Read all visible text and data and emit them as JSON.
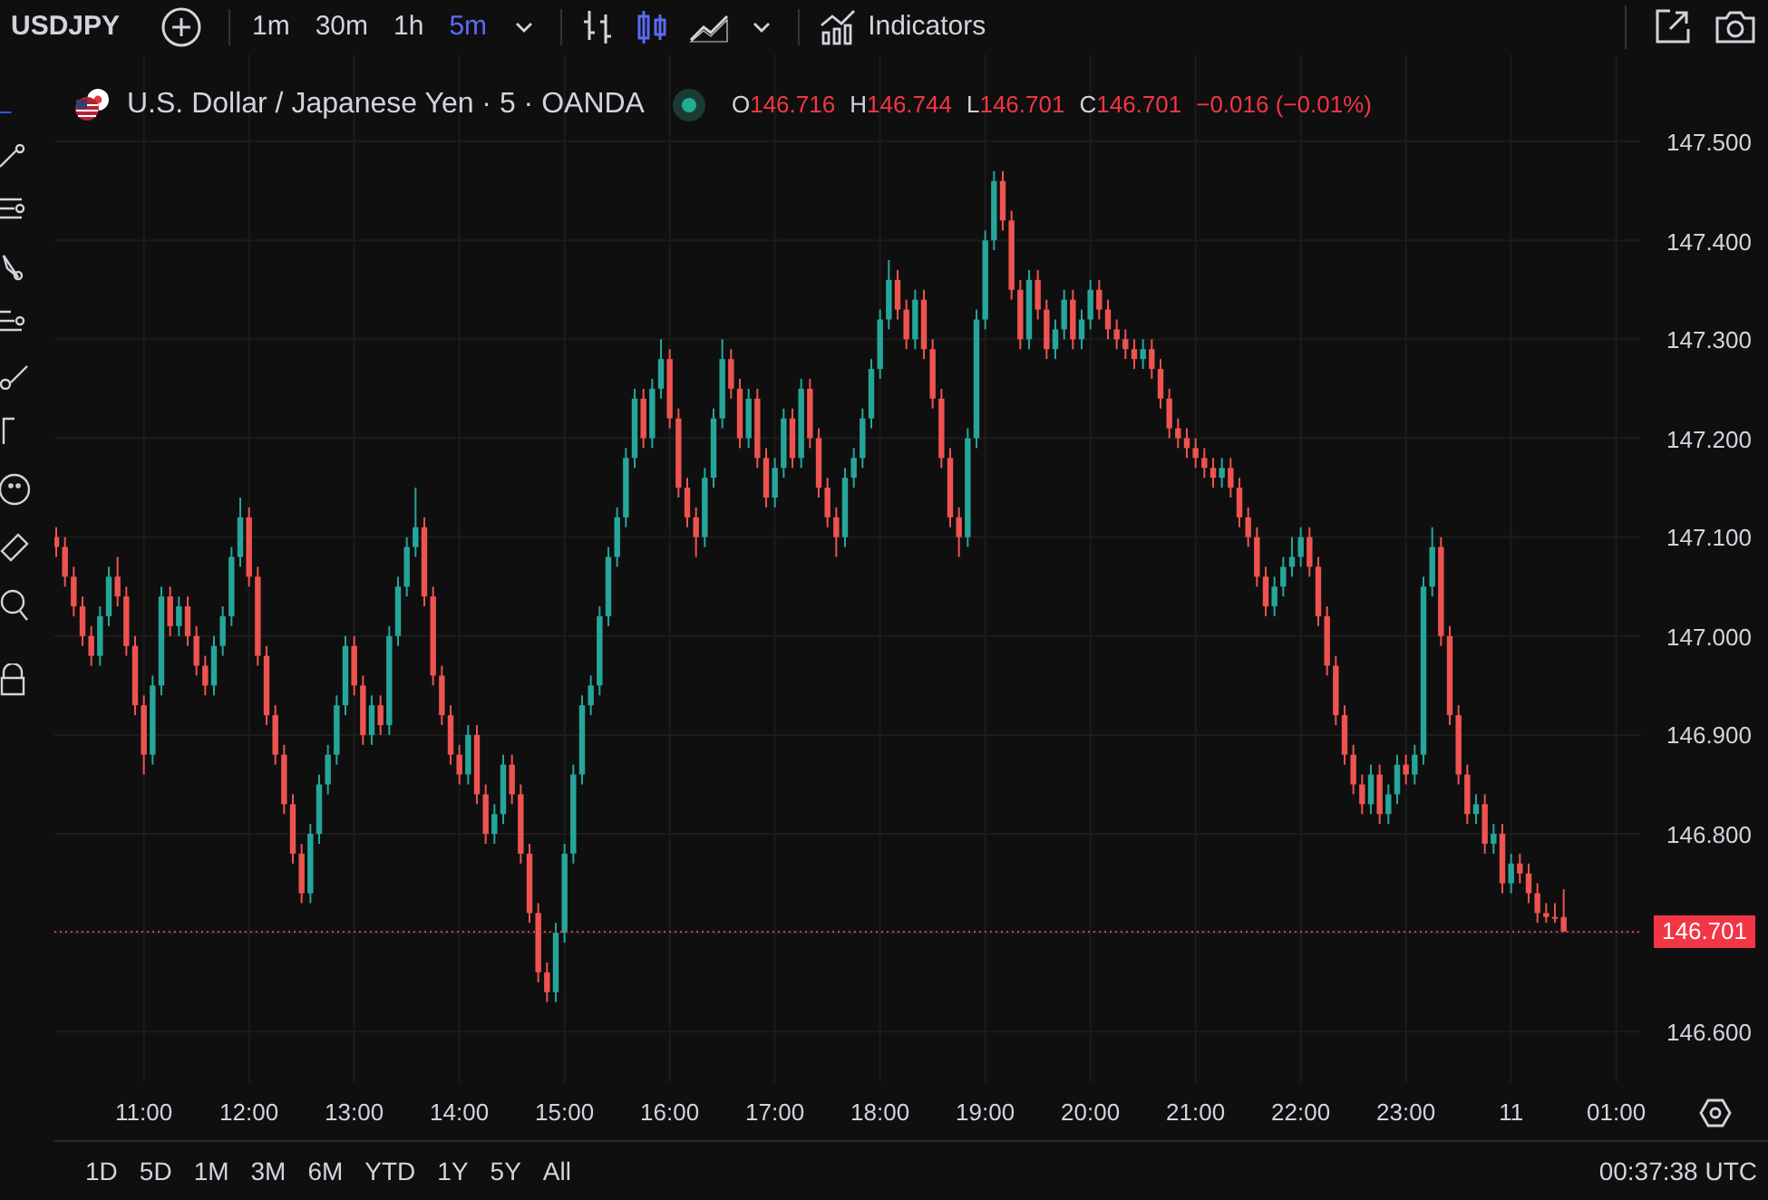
{
  "toolbar": {
    "symbol": "USDJPY",
    "intervals": [
      {
        "label": "1m",
        "selected": false
      },
      {
        "label": "30m",
        "selected": false
      },
      {
        "label": "1h",
        "selected": false
      },
      {
        "label": "5m",
        "selected": true
      }
    ],
    "chart_types": [
      {
        "kind": "bars",
        "selected": false
      },
      {
        "kind": "candles",
        "selected": true
      },
      {
        "kind": "area",
        "selected": false
      }
    ],
    "indicators": "Indicators"
  },
  "legend": {
    "title": "U.S. Dollar / Japanese Yen · 5 · OANDA",
    "values": [
      {
        "label": "O",
        "value": "146.716"
      },
      {
        "label": "H",
        "value": "146.744"
      },
      {
        "label": "L",
        "value": "146.701"
      },
      {
        "label": "C",
        "value": "146.701"
      }
    ],
    "change": "−0.016 (−0.01%)"
  },
  "chart_data": {
    "type": "candlestick",
    "ylim": [
      146.549,
      147.588
    ],
    "grid": true,
    "xlim": [
      10.1494,
      25.2356
    ],
    "x": [
      10.1667,
      10.25,
      10.3333,
      10.4167,
      10.5,
      10.5833,
      10.6667,
      10.75,
      10.8333,
      10.9167,
      11,
      11.0833,
      11.1667,
      11.25,
      11.3333,
      11.4167,
      11.5,
      11.5833,
      11.6667,
      11.75,
      11.8333,
      11.9167,
      12,
      12.0833,
      12.1667,
      12.25,
      12.3333,
      12.4167,
      12.5,
      12.5833,
      12.6667,
      12.75,
      12.8333,
      12.9167,
      13,
      13.0833,
      13.1667,
      13.25,
      13.3333,
      13.4167,
      13.5,
      13.5833,
      13.6667,
      13.75,
      13.8333,
      13.9167,
      14,
      14.0833,
      14.1667,
      14.25,
      14.3333,
      14.4167,
      14.5,
      14.5833,
      14.6667,
      14.75,
      14.8333,
      14.9167,
      15,
      15.0833,
      15.1667,
      15.25,
      15.3333,
      15.4167,
      15.5,
      15.5833,
      15.6667,
      15.75,
      15.8333,
      15.9167,
      16,
      16.0833,
      16.1667,
      16.25,
      16.3333,
      16.4167,
      16.5,
      16.5833,
      16.6667,
      16.75,
      16.8333,
      16.9167,
      17,
      17.0833,
      17.1667,
      17.25,
      17.3333,
      17.4167,
      17.5,
      17.5833,
      17.6667,
      17.75,
      17.8333,
      17.9167,
      18,
      18.0833,
      18.1667,
      18.25,
      18.3333,
      18.4167,
      18.5,
      18.5833,
      18.6667,
      18.75,
      18.8333,
      18.9167,
      19,
      19.0833,
      19.1667,
      19.25,
      19.3333,
      19.4167,
      19.5,
      19.5833,
      19.6667,
      19.75,
      19.8333,
      19.9167,
      20,
      20.0833,
      20.1667,
      20.25,
      20.3333,
      20.4167,
      20.5,
      20.5833,
      20.6667,
      20.75,
      20.8333,
      20.9167,
      21,
      21.0833,
      21.1667,
      21.25,
      21.3333,
      21.4167,
      21.5,
      21.5833,
      21.6667,
      21.75,
      21.8333,
      21.9167,
      22,
      22.0833,
      22.1667,
      22.25,
      22.3333,
      22.4167,
      22.5,
      22.5833,
      22.6667,
      22.75,
      22.8333,
      22.9167,
      23,
      23.0833,
      23.1667,
      23.25,
      23.3333,
      23.4167,
      23.5,
      23.5833,
      23.6667,
      23.75,
      23.8333,
      23.9167,
      24,
      24.0833,
      24.1667,
      24.25,
      24.3333,
      24.4167,
      24.5
    ],
    "ohlc": [
      [
        147.1,
        147.11,
        147.08,
        147.09
      ],
      [
        147.09,
        147.1,
        147.05,
        147.06
      ],
      [
        147.06,
        147.07,
        147.02,
        147.03
      ],
      [
        147.03,
        147.04,
        146.99,
        147.0
      ],
      [
        147.0,
        147.01,
        146.97,
        146.98
      ],
      [
        146.98,
        147.03,
        146.97,
        147.02
      ],
      [
        147.02,
        147.07,
        147.01,
        147.06
      ],
      [
        147.06,
        147.08,
        147.03,
        147.04
      ],
      [
        147.04,
        147.05,
        146.98,
        146.99
      ],
      [
        146.99,
        147.0,
        146.92,
        146.93
      ],
      [
        146.93,
        146.94,
        146.86,
        146.88
      ],
      [
        146.88,
        146.96,
        146.87,
        146.95
      ],
      [
        146.95,
        147.05,
        146.94,
        147.04
      ],
      [
        147.04,
        147.05,
        147.0,
        147.01
      ],
      [
        147.01,
        147.04,
        147.0,
        147.03
      ],
      [
        147.03,
        147.04,
        146.99,
        147.0
      ],
      [
        147.0,
        147.01,
        146.96,
        146.97
      ],
      [
        146.97,
        146.98,
        146.94,
        146.95
      ],
      [
        146.95,
        147.0,
        146.94,
        146.99
      ],
      [
        146.99,
        147.03,
        146.98,
        147.02
      ],
      [
        147.02,
        147.09,
        147.01,
        147.08
      ],
      [
        147.08,
        147.14,
        147.07,
        147.12
      ],
      [
        147.12,
        147.13,
        147.05,
        147.06
      ],
      [
        147.06,
        147.07,
        146.97,
        146.98
      ],
      [
        146.98,
        146.99,
        146.91,
        146.92
      ],
      [
        146.92,
        146.93,
        146.87,
        146.88
      ],
      [
        146.88,
        146.89,
        146.82,
        146.83
      ],
      [
        146.83,
        146.84,
        146.77,
        146.78
      ],
      [
        146.78,
        146.79,
        146.73,
        146.74
      ],
      [
        146.74,
        146.81,
        146.73,
        146.8
      ],
      [
        146.8,
        146.86,
        146.79,
        146.85
      ],
      [
        146.85,
        146.89,
        146.84,
        146.88
      ],
      [
        146.88,
        146.94,
        146.87,
        146.93
      ],
      [
        146.93,
        147.0,
        146.92,
        146.99
      ],
      [
        146.99,
        147.0,
        146.94,
        146.95
      ],
      [
        146.95,
        146.96,
        146.89,
        146.9
      ],
      [
        146.9,
        146.94,
        146.89,
        146.93
      ],
      [
        146.93,
        146.94,
        146.9,
        146.91
      ],
      [
        146.91,
        147.01,
        146.9,
        147.0
      ],
      [
        147.0,
        147.06,
        146.99,
        147.05
      ],
      [
        147.05,
        147.1,
        147.04,
        147.09
      ],
      [
        147.09,
        147.15,
        147.08,
        147.11
      ],
      [
        147.11,
        147.12,
        147.03,
        147.04
      ],
      [
        147.04,
        147.05,
        146.95,
        146.96
      ],
      [
        146.96,
        146.97,
        146.91,
        146.92
      ],
      [
        146.92,
        146.93,
        146.87,
        146.88
      ],
      [
        146.88,
        146.89,
        146.85,
        146.86
      ],
      [
        146.86,
        146.91,
        146.85,
        146.9
      ],
      [
        146.9,
        146.91,
        146.83,
        146.84
      ],
      [
        146.84,
        146.85,
        146.79,
        146.8
      ],
      [
        146.8,
        146.83,
        146.79,
        146.82
      ],
      [
        146.82,
        146.88,
        146.81,
        146.87
      ],
      [
        146.87,
        146.88,
        146.83,
        146.84
      ],
      [
        146.84,
        146.85,
        146.77,
        146.78
      ],
      [
        146.78,
        146.79,
        146.71,
        146.72
      ],
      [
        146.72,
        146.73,
        146.65,
        146.66
      ],
      [
        146.66,
        146.67,
        146.63,
        146.64
      ],
      [
        146.64,
        146.71,
        146.63,
        146.7
      ],
      [
        146.7,
        146.79,
        146.69,
        146.78
      ],
      [
        146.78,
        146.87,
        146.77,
        146.86
      ],
      [
        146.86,
        146.94,
        146.85,
        146.93
      ],
      [
        146.93,
        146.96,
        146.92,
        146.95
      ],
      [
        146.95,
        147.03,
        146.94,
        147.02
      ],
      [
        147.02,
        147.09,
        147.01,
        147.08
      ],
      [
        147.08,
        147.13,
        147.07,
        147.12
      ],
      [
        147.12,
        147.19,
        147.11,
        147.18
      ],
      [
        147.18,
        147.25,
        147.17,
        147.24
      ],
      [
        147.24,
        147.25,
        147.19,
        147.2
      ],
      [
        147.2,
        147.26,
        147.19,
        147.25
      ],
      [
        147.25,
        147.3,
        147.24,
        147.28
      ],
      [
        147.28,
        147.29,
        147.21,
        147.22
      ],
      [
        147.22,
        147.23,
        147.14,
        147.15
      ],
      [
        147.15,
        147.16,
        147.11,
        147.12
      ],
      [
        147.12,
        147.13,
        147.08,
        147.1
      ],
      [
        147.1,
        147.17,
        147.09,
        147.16
      ],
      [
        147.16,
        147.23,
        147.15,
        147.22
      ],
      [
        147.22,
        147.3,
        147.21,
        147.28
      ],
      [
        147.28,
        147.29,
        147.24,
        147.25
      ],
      [
        147.25,
        147.26,
        147.19,
        147.2
      ],
      [
        147.2,
        147.25,
        147.19,
        147.24
      ],
      [
        147.24,
        147.25,
        147.17,
        147.18
      ],
      [
        147.18,
        147.19,
        147.13,
        147.14
      ],
      [
        147.14,
        147.18,
        147.13,
        147.17
      ],
      [
        147.17,
        147.23,
        147.16,
        147.22
      ],
      [
        147.22,
        147.23,
        147.17,
        147.18
      ],
      [
        147.18,
        147.26,
        147.17,
        147.25
      ],
      [
        147.25,
        147.26,
        147.19,
        147.2
      ],
      [
        147.2,
        147.21,
        147.14,
        147.15
      ],
      [
        147.15,
        147.16,
        147.11,
        147.12
      ],
      [
        147.12,
        147.13,
        147.08,
        147.1
      ],
      [
        147.1,
        147.17,
        147.09,
        147.16
      ],
      [
        147.16,
        147.19,
        147.15,
        147.18
      ],
      [
        147.18,
        147.23,
        147.17,
        147.22
      ],
      [
        147.22,
        147.28,
        147.21,
        147.27
      ],
      [
        147.27,
        147.33,
        147.26,
        147.32
      ],
      [
        147.32,
        147.38,
        147.31,
        147.36
      ],
      [
        147.36,
        147.37,
        147.32,
        147.33
      ],
      [
        147.33,
        147.34,
        147.29,
        147.3
      ],
      [
        147.3,
        147.35,
        147.29,
        147.34
      ],
      [
        147.34,
        147.35,
        147.28,
        147.29
      ],
      [
        147.29,
        147.3,
        147.23,
        147.24
      ],
      [
        147.24,
        147.25,
        147.17,
        147.18
      ],
      [
        147.18,
        147.19,
        147.11,
        147.12
      ],
      [
        147.12,
        147.13,
        147.08,
        147.1
      ],
      [
        147.1,
        147.21,
        147.09,
        147.2
      ],
      [
        147.2,
        147.33,
        147.19,
        147.32
      ],
      [
        147.32,
        147.41,
        147.31,
        147.4
      ],
      [
        147.4,
        147.47,
        147.39,
        147.46
      ],
      [
        147.46,
        147.47,
        147.41,
        147.42
      ],
      [
        147.42,
        147.43,
        147.34,
        147.35
      ],
      [
        147.35,
        147.36,
        147.29,
        147.3
      ],
      [
        147.3,
        147.37,
        147.29,
        147.36
      ],
      [
        147.36,
        147.37,
        147.32,
        147.33
      ],
      [
        147.33,
        147.34,
        147.28,
        147.29
      ],
      [
        147.29,
        147.32,
        147.28,
        147.31
      ],
      [
        147.31,
        147.35,
        147.3,
        147.34
      ],
      [
        147.34,
        147.35,
        147.29,
        147.3
      ],
      [
        147.3,
        147.33,
        147.29,
        147.32
      ],
      [
        147.32,
        147.36,
        147.31,
        147.35
      ],
      [
        147.35,
        147.36,
        147.32,
        147.33
      ],
      [
        147.33,
        147.34,
        147.3,
        147.31
      ],
      [
        147.31,
        147.32,
        147.29,
        147.3
      ],
      [
        147.3,
        147.31,
        147.28,
        147.29
      ],
      [
        147.29,
        147.3,
        147.27,
        147.28
      ],
      [
        147.28,
        147.3,
        147.27,
        147.29
      ],
      [
        147.29,
        147.3,
        147.26,
        147.27
      ],
      [
        147.27,
        147.28,
        147.23,
        147.24
      ],
      [
        147.24,
        147.25,
        147.2,
        147.21
      ],
      [
        147.21,
        147.22,
        147.19,
        147.2
      ],
      [
        147.2,
        147.21,
        147.18,
        147.19
      ],
      [
        147.19,
        147.2,
        147.17,
        147.18
      ],
      [
        147.18,
        147.19,
        147.16,
        147.17
      ],
      [
        147.17,
        147.18,
        147.15,
        147.16
      ],
      [
        147.16,
        147.18,
        147.15,
        147.17
      ],
      [
        147.17,
        147.18,
        147.14,
        147.15
      ],
      [
        147.15,
        147.16,
        147.11,
        147.12
      ],
      [
        147.12,
        147.13,
        147.09,
        147.1
      ],
      [
        147.1,
        147.11,
        147.05,
        147.06
      ],
      [
        147.06,
        147.07,
        147.02,
        147.03
      ],
      [
        147.03,
        147.06,
        147.02,
        147.05
      ],
      [
        147.05,
        147.08,
        147.04,
        147.07
      ],
      [
        147.07,
        147.1,
        147.06,
        147.08
      ],
      [
        147.08,
        147.11,
        147.07,
        147.1
      ],
      [
        147.1,
        147.11,
        147.06,
        147.07
      ],
      [
        147.07,
        147.08,
        147.01,
        147.02
      ],
      [
        147.02,
        147.03,
        146.96,
        146.97
      ],
      [
        146.97,
        146.98,
        146.91,
        146.92
      ],
      [
        146.92,
        146.93,
        146.87,
        146.88
      ],
      [
        146.88,
        146.89,
        146.84,
        146.85
      ],
      [
        146.85,
        146.86,
        146.82,
        146.83
      ],
      [
        146.83,
        146.87,
        146.82,
        146.86
      ],
      [
        146.86,
        146.87,
        146.81,
        146.82
      ],
      [
        146.82,
        146.85,
        146.81,
        146.84
      ],
      [
        146.84,
        146.88,
        146.83,
        146.87
      ],
      [
        146.87,
        146.88,
        146.85,
        146.86
      ],
      [
        146.86,
        146.89,
        146.85,
        146.88
      ],
      [
        146.88,
        147.06,
        146.87,
        147.05
      ],
      [
        147.05,
        147.11,
        147.04,
        147.09
      ],
      [
        147.09,
        147.1,
        146.99,
        147.0
      ],
      [
        147.0,
        147.01,
        146.91,
        146.92
      ],
      [
        146.92,
        146.93,
        146.85,
        146.86
      ],
      [
        146.86,
        146.87,
        146.81,
        146.82
      ],
      [
        146.82,
        146.84,
        146.81,
        146.83
      ],
      [
        146.83,
        146.84,
        146.78,
        146.79
      ],
      [
        146.79,
        146.81,
        146.78,
        146.8
      ],
      [
        146.8,
        146.81,
        146.74,
        146.75
      ],
      [
        146.75,
        146.78,
        146.74,
        146.77
      ],
      [
        146.77,
        146.78,
        146.75,
        146.76
      ],
      [
        146.76,
        146.77,
        146.73,
        146.74
      ],
      [
        146.74,
        146.75,
        146.71,
        146.72
      ],
      [
        146.72,
        146.73,
        146.71,
        146.716
      ],
      [
        146.716,
        146.73,
        146.71,
        146.716
      ],
      [
        146.716,
        146.744,
        146.701,
        146.701
      ]
    ],
    "xticks": [
      {
        "value": 11,
        "label": "11:00"
      },
      {
        "value": 12,
        "label": "12:00"
      },
      {
        "value": 13,
        "label": "13:00"
      },
      {
        "value": 14,
        "label": "14:00"
      },
      {
        "value": 15,
        "label": "15:00"
      },
      {
        "value": 16,
        "label": "16:00"
      },
      {
        "value": 17,
        "label": "17:00"
      },
      {
        "value": 18,
        "label": "18:00"
      },
      {
        "value": 19,
        "label": "19:00"
      },
      {
        "value": 20,
        "label": "20:00"
      },
      {
        "value": 21,
        "label": "21:00"
      },
      {
        "value": 22,
        "label": "22:00"
      },
      {
        "value": 23,
        "label": "23:00"
      }
    ],
    "ref_lines": [
      {
        "axis": "y",
        "value": 146.701,
        "label": "146.701",
        "color": "#f23645"
      }
    ],
    "yticks": [
      {
        "value": 147.5,
        "label": "147.500"
      },
      {
        "value": 147.4,
        "label": "147.400"
      },
      {
        "value": 147.3,
        "label": "147.300"
      },
      {
        "value": 147.2,
        "label": "147.200"
      },
      {
        "value": 147.1,
        "label": "147.100"
      },
      {
        "value": 147.0,
        "label": "147.000"
      },
      {
        "value": 146.9,
        "label": "146.900"
      },
      {
        "value": 146.8,
        "label": "146.800"
      },
      {
        "value": 146.6,
        "label": "146.600"
      }
    ]
  },
  "time_axis_next_day": [
    "11",
    "01:00"
  ],
  "ranges": [
    "1D",
    "5D",
    "1M",
    "3M",
    "6M",
    "YTD",
    "1Y",
    "5Y",
    "All"
  ],
  "clock": "00:37:38 UTC"
}
